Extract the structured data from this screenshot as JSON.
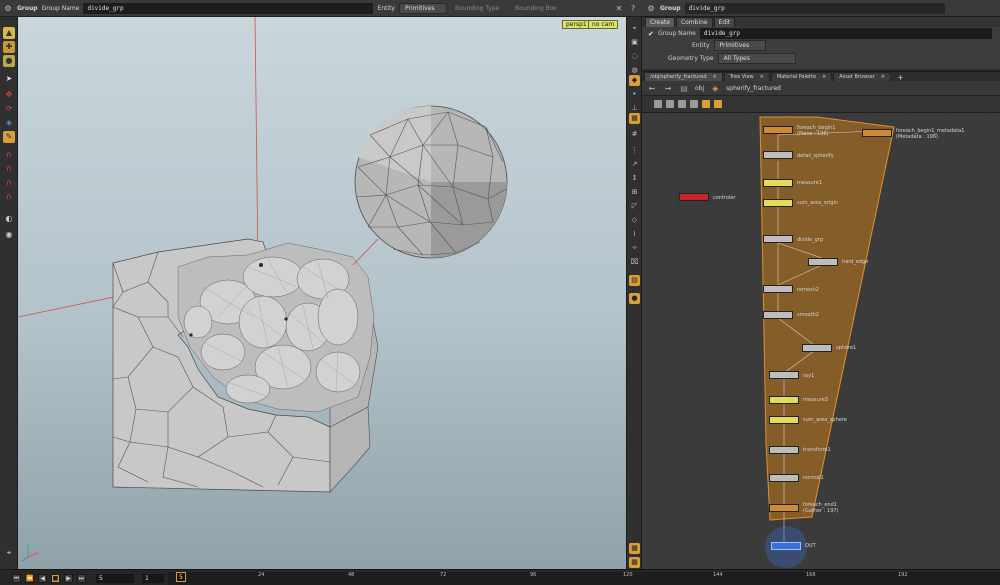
{
  "viewport_header": {
    "node_type": "Group",
    "group_name_label": "Group Name",
    "group_name_value": "divide_grp",
    "entity_label": "Entity",
    "entity_value": "Primitives",
    "bounding_type_label": "Bounding Type",
    "bounding_box_label": "Bounding Box"
  },
  "viewport": {
    "camera_label": "persp1",
    "cam_button": "no cam"
  },
  "param_pane": {
    "node_type": "Group",
    "node_name": "divide_grp",
    "tabs": [
      "Create",
      "Combine",
      "Edit"
    ],
    "group_name_label": "Group Name",
    "group_name_value": "divide_grp",
    "entity_label": "Entity",
    "entity_value": "Primitives",
    "geometry_type_label": "Geometry Type",
    "geometry_type_value": "All Types"
  },
  "network_tabs": [
    "/obj/spherify_fractured",
    "Tree View",
    "Material Palette",
    "Asset Browser"
  ],
  "network_tab_add": "+",
  "network_path": {
    "root": "obj",
    "node": "spherify_fractured"
  },
  "nodes": {
    "foreach_begin1": "foreach_begin1",
    "foreach_begin1_sub": "(Piece : 196)",
    "foreach_begin1_metadata1": "foreach_begin1_metadata1",
    "foreach_begin1_metadata1_sub": "(Metadata : 196)",
    "detail_spherify": "detail_spherify",
    "measure1": "measure1",
    "sum_area_origin": "sum_area_origin",
    "controler": "controler",
    "divide_grp": "divide_grp",
    "hard_edge": "hard_edge",
    "remesh2": "remesh2",
    "smooth2": "smooth2",
    "sphere1": "sphere1",
    "ray1": "ray1",
    "measure3": "measure3",
    "sum_area_sphere": "sum_area_sphere",
    "transform1": "transform1",
    "normal1": "normal1",
    "foreach_end1": "foreach_end1",
    "foreach_end1_sub": "(Gather : 197)",
    "OUT": "OUT"
  },
  "timeline": {
    "current_frame": "5",
    "start_frame": "1",
    "frame_field": "5",
    "ticks": [
      "24",
      "48",
      "72",
      "96",
      "120",
      "144",
      "168",
      "192"
    ]
  },
  "colors": {
    "foreach_network_box": "#c27a1c",
    "node_yellow": "#e3db5a",
    "node_orange": "#d08a35",
    "node_gray": "#bdbdbd",
    "node_red": "#c8262c",
    "node_blue": "#3a6fd8",
    "selected_frame": "#d9a03a"
  }
}
